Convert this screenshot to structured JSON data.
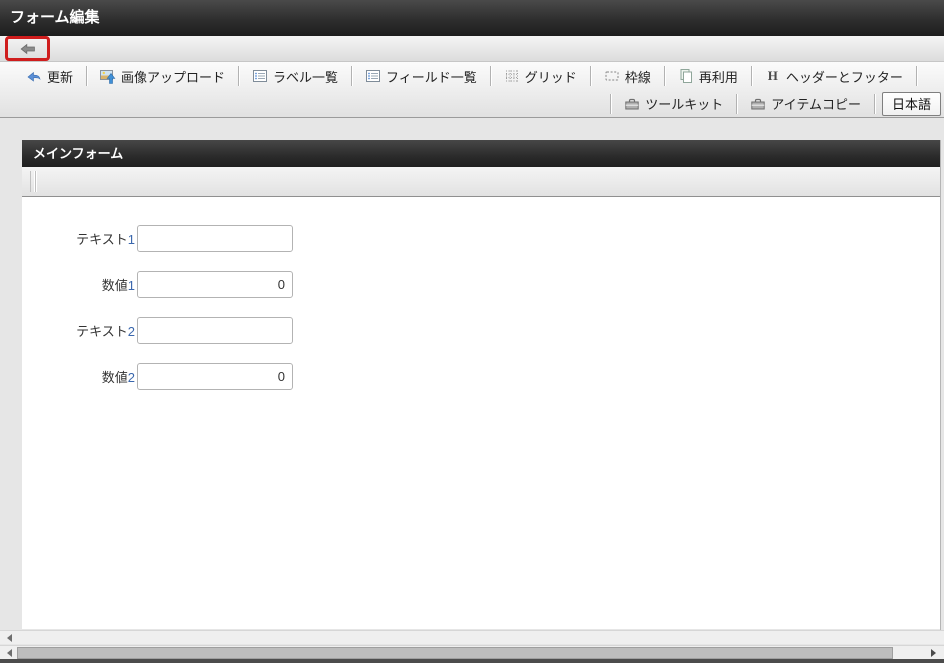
{
  "window": {
    "title": "フォーム編集"
  },
  "toolbar": {
    "row1": [
      {
        "label": "更新",
        "icon": "refresh-icon"
      },
      {
        "label": "画像アップロード",
        "icon": "image-upload-icon"
      },
      {
        "label": "ラベル一覧",
        "icon": "label-list-icon"
      },
      {
        "label": "フィールド一覧",
        "icon": "field-list-icon"
      },
      {
        "label": "グリッド",
        "icon": "grid-icon"
      },
      {
        "label": "枠線",
        "icon": "border-icon"
      },
      {
        "label": "再利用",
        "icon": "reuse-icon"
      },
      {
        "label": "ヘッダーとフッター",
        "icon": "header-footer-icon",
        "icon_text": "H"
      }
    ],
    "row2": [
      {
        "label": "ツールキット",
        "icon": "toolbox-icon"
      },
      {
        "label": "アイテムコピー",
        "icon": "toolbox-icon"
      }
    ],
    "language_button": "日本語"
  },
  "panel": {
    "title": "メインフォーム",
    "fields": [
      {
        "label": "テキスト",
        "index": "1",
        "value": "",
        "type": "text"
      },
      {
        "label": "数値",
        "index": "1",
        "value": "0",
        "type": "number"
      },
      {
        "label": "テキスト",
        "index": "2",
        "value": "",
        "type": "text"
      },
      {
        "label": "数値",
        "index": "2",
        "value": "0",
        "type": "number"
      }
    ]
  },
  "colors": {
    "titlebar_dark": "#2b2b2b",
    "annotation_red": "#cf1d1d",
    "field_index_blue": "#3a67ad",
    "toolbar_gray": "#e1e1e1",
    "scroll_thumb": "#bdbdbd"
  }
}
